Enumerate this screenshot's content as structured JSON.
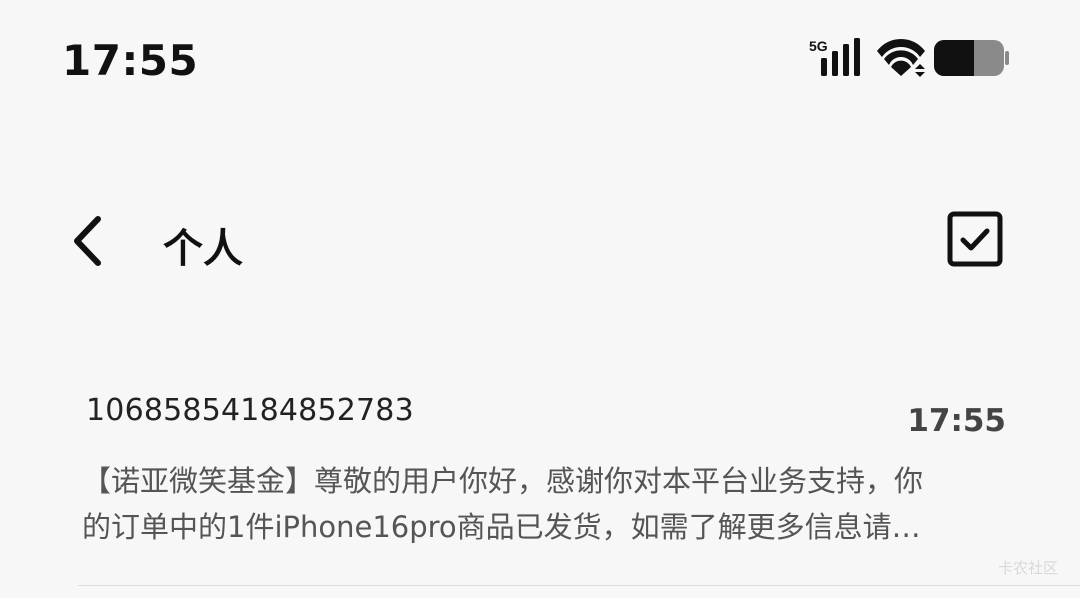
{
  "status_bar": {
    "time": "17:55",
    "network_label": "5G"
  },
  "header": {
    "title": "个人"
  },
  "messages": [
    {
      "sender": "10685854184852783",
      "time": "17:55",
      "preview_line1": "【诺亚微笑基金】尊敬的用户你好，感谢你对本平台业务支持，你",
      "preview_line2": "的订单中的1件iPhone16pro商品已发货，如需了解更多信息请…"
    }
  ],
  "watermark": "卡农社区"
}
